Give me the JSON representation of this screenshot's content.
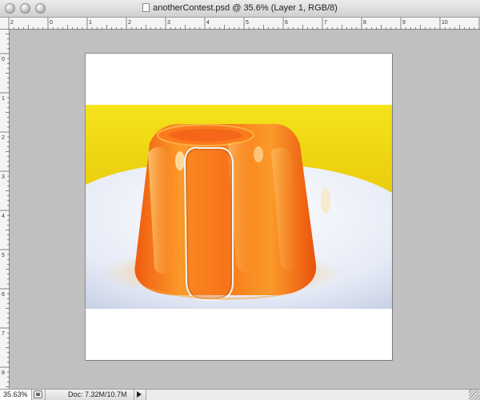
{
  "window": {
    "title": "anotherContest.psd @ 35.6% (Layer 1, RGB/8)"
  },
  "rulers": {
    "top_labels": [
      "2",
      "0",
      "1",
      "2",
      "3",
      "4",
      "5",
      "6",
      "7",
      "8",
      "9",
      "10",
      "11"
    ],
    "left_labels": [
      "0",
      "1",
      "2",
      "3",
      "4",
      "5",
      "6",
      "7",
      "8"
    ]
  },
  "status": {
    "zoom": "35.63%",
    "doc_info": "Doc: 7.32M/10.7M"
  },
  "colors": {
    "canvas_bg": "#c0c0c0",
    "document_bg": "#ffffff",
    "backdrop_yellow": "#f2dc12",
    "jelly_orange": "#f7761c",
    "plate_white": "#eef1f8"
  },
  "icons": {
    "close": "close-button",
    "minimize": "minimize-button",
    "zoom": "zoom-button",
    "document": "document-icon",
    "status_menu": "triangle-right-icon"
  }
}
